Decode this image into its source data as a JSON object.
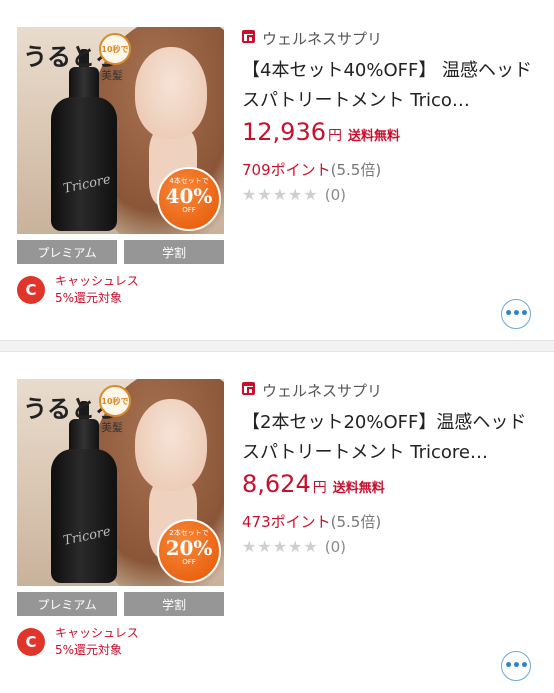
{
  "products": [
    {
      "image": {
        "headline": "うるとろ",
        "seconds_badge": "10秒で",
        "subline": "美髪",
        "bottle_brand": "Tricore",
        "discount_small": "4本セットで",
        "discount_pct": "40%",
        "discount_off": "OFF"
      },
      "tags": [
        "プレミアム",
        "学割"
      ],
      "cashless": {
        "icon": "C",
        "line1": "キャッシュレス",
        "line2": "5%還元対象"
      },
      "shop_name": "ウェルネスサプリ",
      "title": "【4本セット40%OFF】 温感ヘッドスパトリートメント Trico…",
      "price": "12,936",
      "yen": "円",
      "shipping": "送料無料",
      "points": "709ポイント",
      "rate": "(5.5倍)",
      "stars": "★★★★★",
      "review_count": "(0)",
      "more": "•••"
    },
    {
      "image": {
        "headline": "うるとろ",
        "seconds_badge": "10秒で",
        "subline": "美髪",
        "bottle_brand": "Tricore",
        "discount_small": "2本セットで",
        "discount_pct": "20%",
        "discount_off": "OFF"
      },
      "tags": [
        "プレミアム",
        "学割"
      ],
      "cashless": {
        "icon": "C",
        "line1": "キャッシュレス",
        "line2": "5%還元対象"
      },
      "shop_name": "ウェルネスサプリ",
      "title": "【2本セット20%OFF】温感ヘッドスパトリートメント Tricore…",
      "price": "8,624",
      "yen": "円",
      "shipping": "送料無料",
      "points": "473ポイント",
      "rate": "(5.5倍)",
      "stars": "★★★★★",
      "review_count": "(0)",
      "more": "•••"
    }
  ],
  "colors": {
    "price": "#c8102e",
    "tag_bg": "#969696",
    "more_button": "#2d84c8",
    "discount": "#e9600f"
  }
}
